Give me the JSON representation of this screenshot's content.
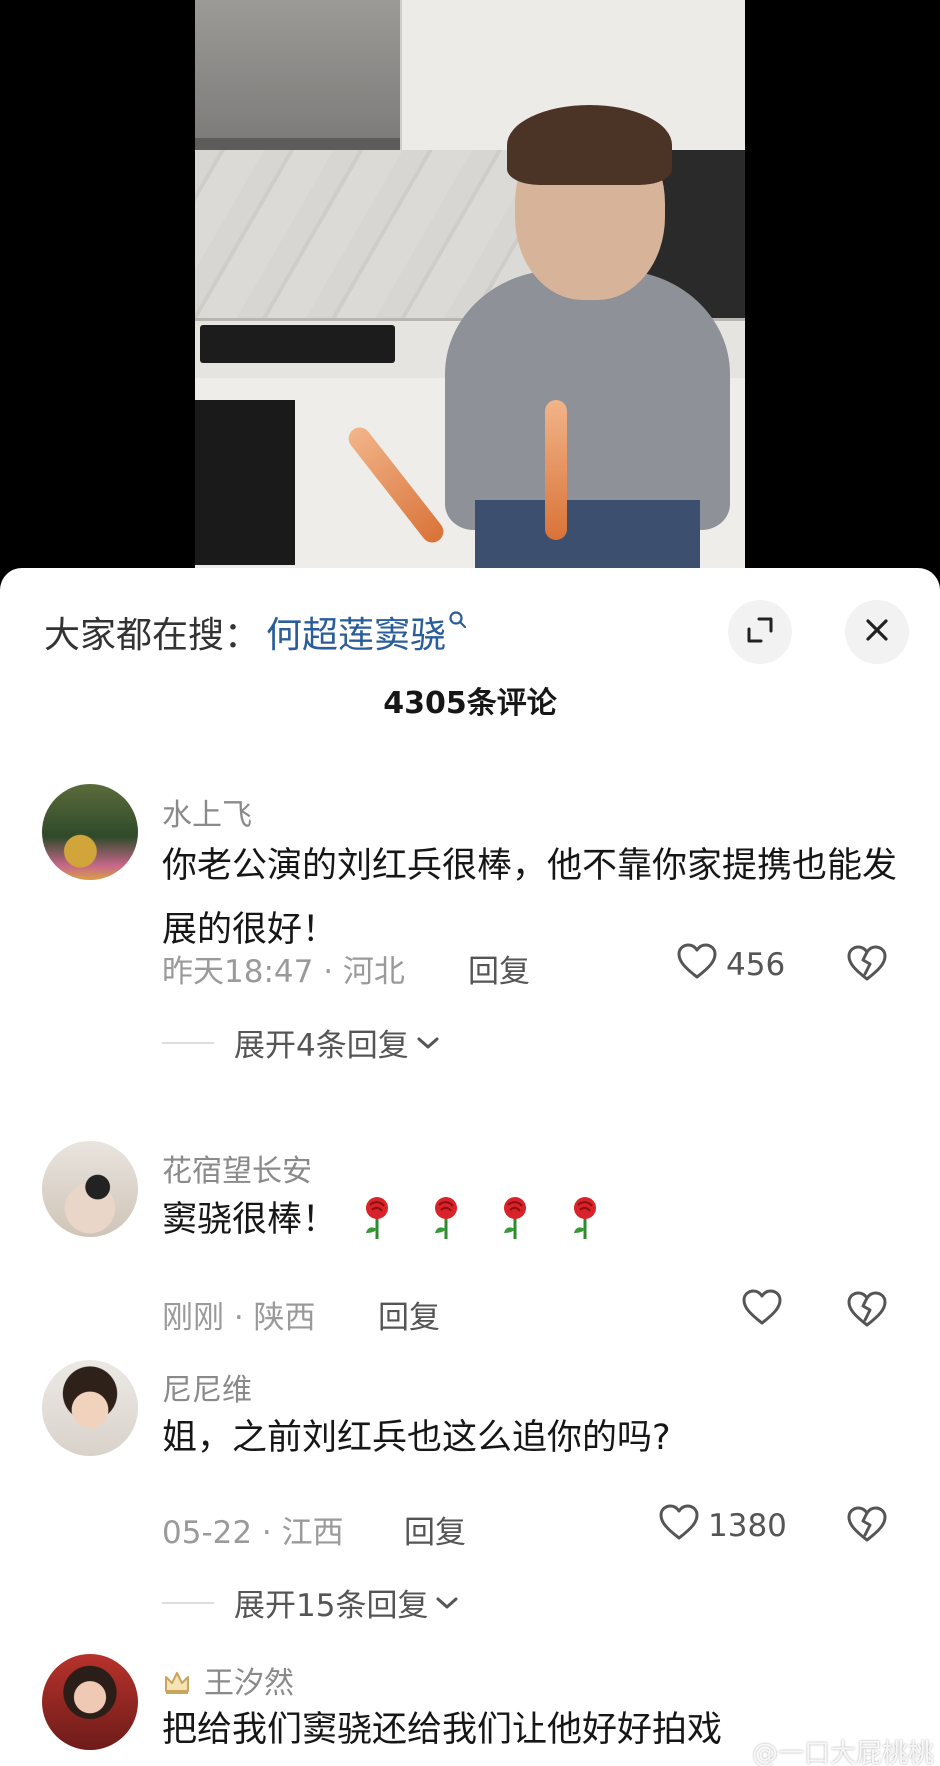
{
  "search": {
    "prefix": "大家都在搜：",
    "query": "何超莲窦骁"
  },
  "comment_count": "4305条评论",
  "comments": [
    {
      "username": "水上飞",
      "text": "你老公演的刘红兵很棒，他不靠你家提携也能发展的很好！",
      "time": "昨天18:47 · 河北",
      "reply_label": "回复",
      "likes": "456",
      "expand_label": "展开4条回复"
    },
    {
      "username": "花宿望长安",
      "text": "窦骁很棒！",
      "time": "刚刚 · 陕西",
      "reply_label": "回复",
      "likes": ""
    },
    {
      "username": "尼尼维",
      "text": "姐，之前刘红兵也这么追你的吗?",
      "time": "05-22 · 江西",
      "reply_label": "回复",
      "likes": "1380",
      "expand_label": "展开15条回复"
    },
    {
      "username": "王汐然",
      "text": "把给我们窦骁还给我们让他好好拍戏"
    }
  ],
  "watermark": "@一口大屁桃桃",
  "colors": {
    "link": "#2a5d9a",
    "sheet_bg": "#ffffff",
    "muted_text": "#9a9a9a"
  },
  "icons": {
    "expand": "expand-icon",
    "close": "close-icon",
    "like": "heart-icon",
    "dislike": "broken-heart-icon",
    "chevron": "chevron-down-icon",
    "search": "search-icon",
    "rose": "rose-emoji",
    "crown": "crown-badge-icon"
  }
}
